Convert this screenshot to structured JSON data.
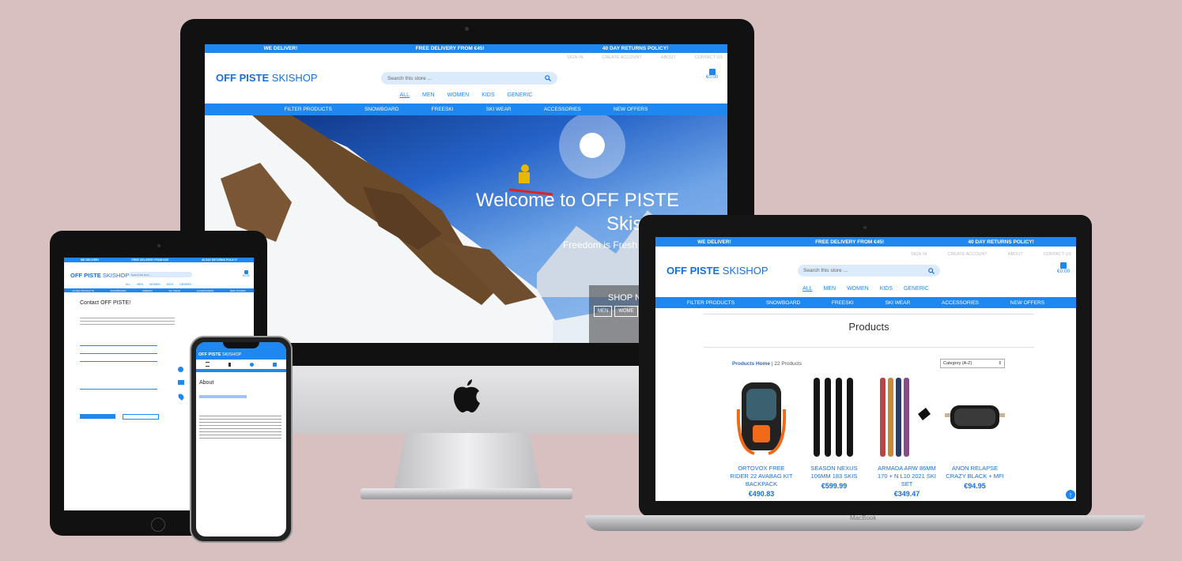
{
  "banner": [
    "WE DELIVER!",
    "FREE DELIVERY FROM €45!",
    "40 DAY RETURNS POLICY!"
  ],
  "brand": {
    "bold": "OFF PISTE",
    "rest": " SKISHOP"
  },
  "top_links": [
    "SIGN IN",
    "CREATE ACCOUNT",
    "ABOUT",
    "CONTACT US"
  ],
  "search": {
    "placeholder": "Search this store ..."
  },
  "basket": {
    "total": "€0.00"
  },
  "categories": [
    "ALL",
    "MEN",
    "WOMEN",
    "KIDS",
    "GENERIC"
  ],
  "main_nav": [
    "FILTER PRODUCTS",
    "SNOWBOARD",
    "FREESKI",
    "SKI WEAR",
    "ACCESSORIES",
    "NEW OFFERS"
  ],
  "hero": {
    "title_line1": "Welcome to OFF PISTE",
    "title_line2": "Skis",
    "subtitle": "Freedom is Fresh",
    "shop_now": "SHOP N",
    "buttons": [
      "MEN",
      "WOME"
    ]
  },
  "contact": {
    "title": "Contact OFF PISTE!"
  },
  "about": {
    "title": "About"
  },
  "products": {
    "title": "Products",
    "breadcrumb_link": "Products Home",
    "count": "| 22 Products",
    "sort": "Category (A-Z)",
    "items": [
      {
        "name": "ORTOVOX FREE RIDER 22 AVABAG KIT BACKPACK",
        "price": "€490.83"
      },
      {
        "name": "SEASON NEXUS 106MM 183 SKIS",
        "price": "€599.99"
      },
      {
        "name": "ARMADA ARW 86MM 170 + N L10 2021 SKI SET",
        "price": "€349.47"
      },
      {
        "name": "ANON RELAPSE CRAZY BLACK + MFI",
        "price": "€94.95"
      }
    ]
  },
  "laptop_label": "MacBook",
  "colors": {
    "accent": "#1e88f0",
    "brand": "#1a6fd6",
    "background": "#d8bfc0"
  }
}
